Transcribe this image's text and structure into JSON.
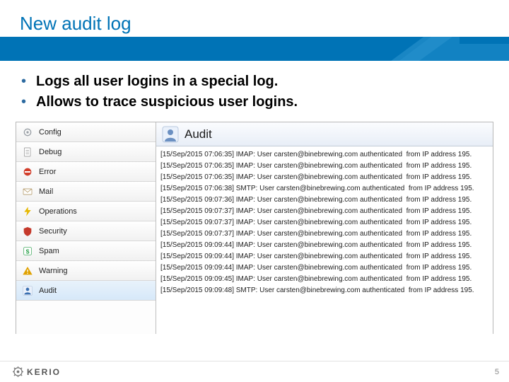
{
  "header": {
    "title": "New audit log"
  },
  "bullets": [
    "Logs all user logins in a special log.",
    "Allows to trace suspicious user logins."
  ],
  "sidebar": {
    "items": [
      {
        "label": "Config",
        "icon": "gear-icon",
        "color": "#9aa0a6"
      },
      {
        "label": "Debug",
        "icon": "page-icon",
        "color": "#8a8a8a"
      },
      {
        "label": "Error",
        "icon": "no-entry-icon",
        "color": "#d23d2a"
      },
      {
        "label": "Mail",
        "icon": "envelope-icon",
        "color": "#a98b52"
      },
      {
        "label": "Operations",
        "icon": "bolt-icon",
        "color": "#e6b800"
      },
      {
        "label": "Security",
        "icon": "shield-icon",
        "color": "#c5392b"
      },
      {
        "label": "Spam",
        "icon": "dollar-icon",
        "color": "#2fa24f"
      },
      {
        "label": "Warning",
        "icon": "warning-icon",
        "color": "#e0a100"
      },
      {
        "label": "Audit",
        "icon": "user-icon",
        "color": "#3a6fb0",
        "active": true
      }
    ]
  },
  "mainPane": {
    "title": "Audit",
    "icon": "user-icon"
  },
  "log": {
    "rows": [
      {
        "ts": "15/Sep/2015 07:06:35",
        "proto": "IMAP",
        "user": "carsten@binebrewing.com",
        "ip": "195."
      },
      {
        "ts": "15/Sep/2015 07:06:35",
        "proto": "IMAP",
        "user": "carsten@binebrewing.com",
        "ip": "195."
      },
      {
        "ts": "15/Sep/2015 07:06:35",
        "proto": "IMAP",
        "user": "carsten@binebrewing.com",
        "ip": "195."
      },
      {
        "ts": "15/Sep/2015 07:06:38",
        "proto": "SMTP",
        "user": "carsten@binebrewing.com",
        "ip": "195."
      },
      {
        "ts": "15/Sep/2015 09:07:36",
        "proto": "IMAP",
        "user": "carsten@binebrewing.com",
        "ip": "195."
      },
      {
        "ts": "15/Sep/2015 09:07:37",
        "proto": "IMAP",
        "user": "carsten@binebrewing.com",
        "ip": "195."
      },
      {
        "ts": "15/Sep/2015 09:07:37",
        "proto": "IMAP",
        "user": "carsten@binebrewing.com",
        "ip": "195."
      },
      {
        "ts": "15/Sep/2015 09:07:37",
        "proto": "IMAP",
        "user": "carsten@binebrewing.com",
        "ip": "195."
      },
      {
        "ts": "15/Sep/2015 09:09:44",
        "proto": "IMAP",
        "user": "carsten@binebrewing.com",
        "ip": "195."
      },
      {
        "ts": "15/Sep/2015 09:09:44",
        "proto": "IMAP",
        "user": "carsten@binebrewing.com",
        "ip": "195."
      },
      {
        "ts": "15/Sep/2015 09:09:44",
        "proto": "IMAP",
        "user": "carsten@binebrewing.com",
        "ip": "195."
      },
      {
        "ts": "15/Sep/2015 09:09:45",
        "proto": "IMAP",
        "user": "carsten@binebrewing.com",
        "ip": "195."
      },
      {
        "ts": "15/Sep/2015 09:09:48",
        "proto": "SMTP",
        "user": "carsten@binebrewing.com",
        "ip": "195."
      }
    ],
    "suffix_after_auth": "  from IP address "
  },
  "footer": {
    "brand": "KERIO",
    "page": "5"
  },
  "colors": {
    "accent": "#0073b6"
  }
}
